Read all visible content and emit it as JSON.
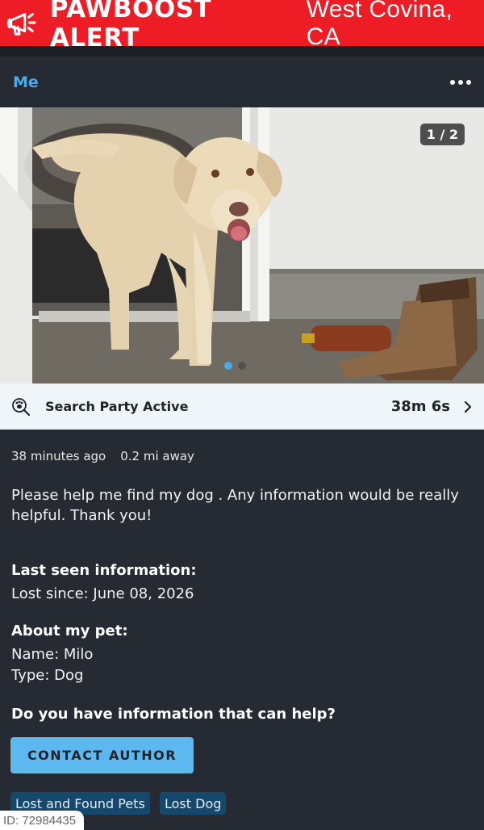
{
  "alert": {
    "title": "PAWBOOST ALERT",
    "location": "West Covina, CA",
    "icon": "megaphone-icon",
    "bg_color": "#ee1c24"
  },
  "header": {
    "user": "Me",
    "more_icon": "more-horizontal-icon"
  },
  "photo": {
    "counter": "1 / 2",
    "current_index": 1,
    "total": 2
  },
  "search_party": {
    "label": "Search Party Active",
    "time": "38m 6s",
    "icon": "paw-search-icon",
    "chevron_icon": "chevron-right-icon"
  },
  "post": {
    "posted_ago": "38 minutes ago",
    "distance": "0.2 mi away",
    "description": "Please help me find my dog . Any information would be really helpful. Thank you!"
  },
  "last_seen": {
    "title": "Last seen information:",
    "lost_since": "Lost since: June 08, 2026"
  },
  "about_pet": {
    "title": "About my pet:",
    "name": "Name: Milo",
    "type": "Type: Dog"
  },
  "help": {
    "question": "Do you have information that can help?",
    "contact_button": "CONTACT AUTHOR"
  },
  "tags": [
    "Lost and Found Pets",
    "Lost Dog"
  ],
  "id_label": "ID: 72984435",
  "colors": {
    "background": "#262a33",
    "accent": "#4aa9e9",
    "button": "#5cb8ef",
    "tag_bg": "#14486c"
  }
}
